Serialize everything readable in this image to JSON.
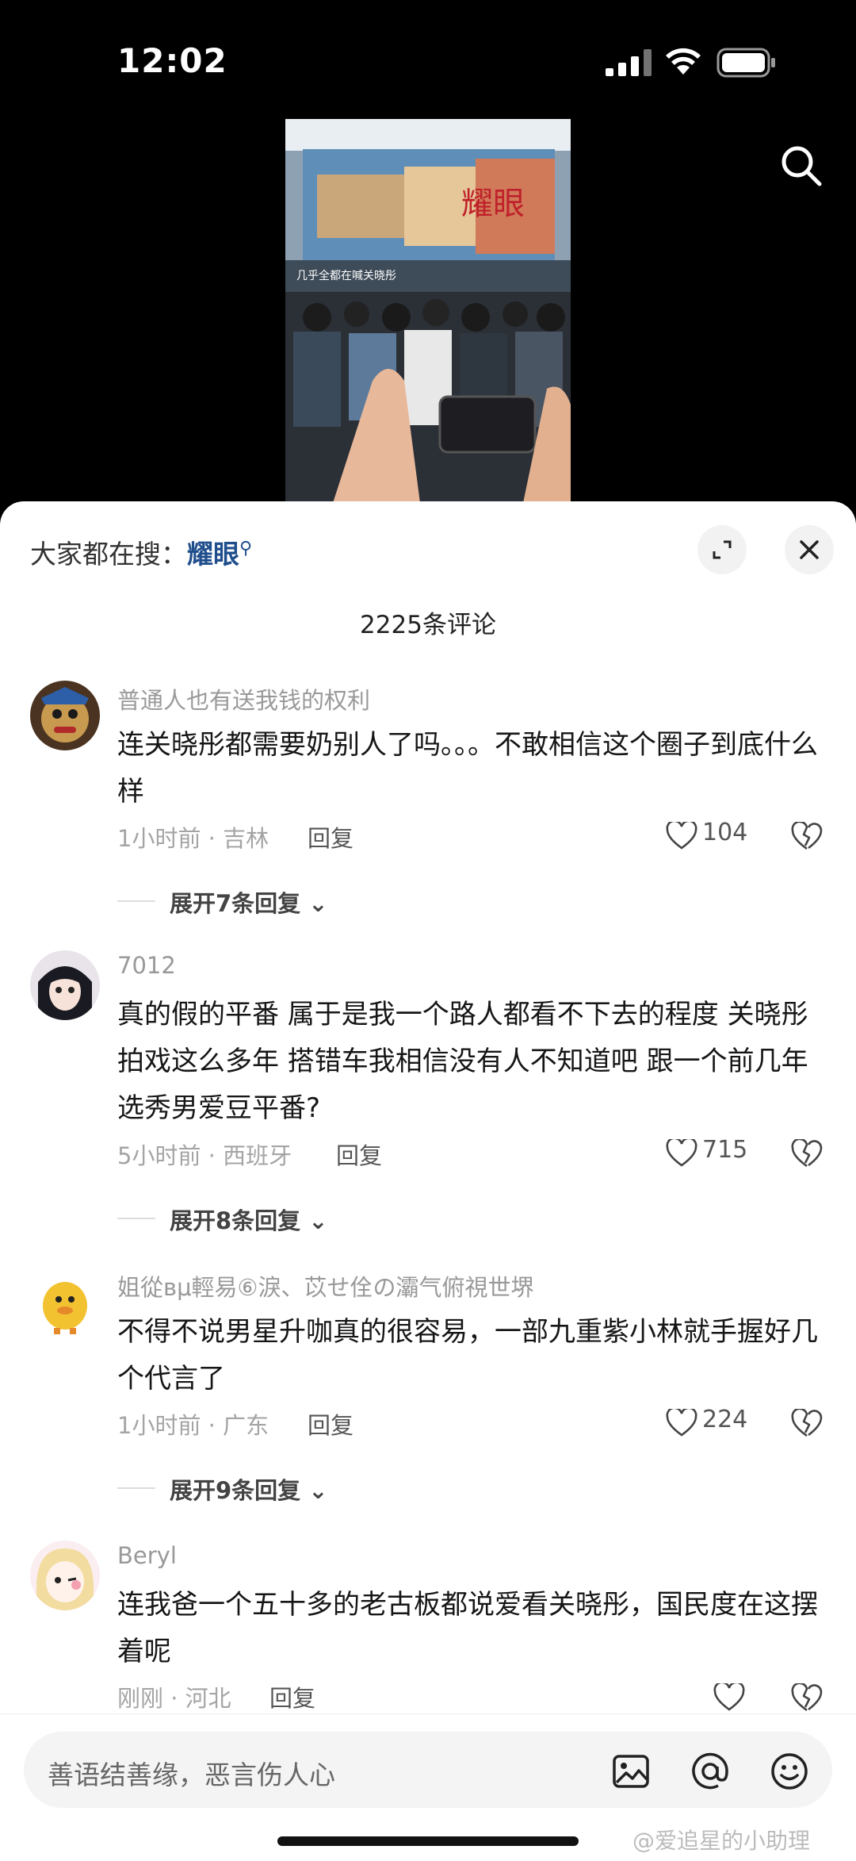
{
  "status_bar": {
    "time": "12:02"
  },
  "video": {
    "overlay_caption": "几乎全都在喊关晓彤",
    "poster_title": "耀眼"
  },
  "header": {
    "hot_search_label": "大家都在搜：",
    "hot_search_keyword": "耀眼",
    "comment_count": "2225条评论"
  },
  "comments": [
    {
      "user": "普通人也有送我钱的权利",
      "text": "连关晓彤都需要奶别人了吗。。。不敢相信这个圈子到底什么样",
      "meta": "1小时前 · 吉林",
      "reply": "回复",
      "likes": "104",
      "expand": "展开7条回复"
    },
    {
      "user": "7012",
      "text": "真的假的平番 属于是我一个路人都看不下去的程度 关晓彤拍戏这么多年 搭错车我相信没有人不知道吧 跟一个前几年选秀男爱豆平番?",
      "meta": "5小时前 · 西班牙",
      "reply": "回复",
      "likes": "715",
      "expand": "展开8条回复"
    },
    {
      "user": "姐從вμ輕易⑥淚、苡せ佺の灞气俯視世堺",
      "text": "不得不说男星升咖真的很容易，一部九重紫小林就手握好几个代言了",
      "meta": "1小时前 · 广东",
      "reply": "回复",
      "likes": "224",
      "expand": "展开9条回复"
    },
    {
      "user": "Beryl",
      "text": "连我爸一个五十多的老古板都说爱看关晓彤，国民度在这摆着呢",
      "meta": "刚刚 · 河北",
      "reply": "回复",
      "likes": "",
      "expand": ""
    }
  ],
  "input": {
    "placeholder": "善语结善缘，恶言伤人心"
  },
  "watermark": "@爱追星的小助理",
  "icons": [
    "search-icon",
    "expand-icon",
    "close-icon",
    "heart-icon",
    "broken-heart-icon",
    "chevron-down-icon",
    "image-icon",
    "at-icon",
    "emoji-icon"
  ],
  "colors": {
    "keyword": "#1f4e8c",
    "sheet_bg": "#ffffff",
    "video_bg": "#000000"
  }
}
